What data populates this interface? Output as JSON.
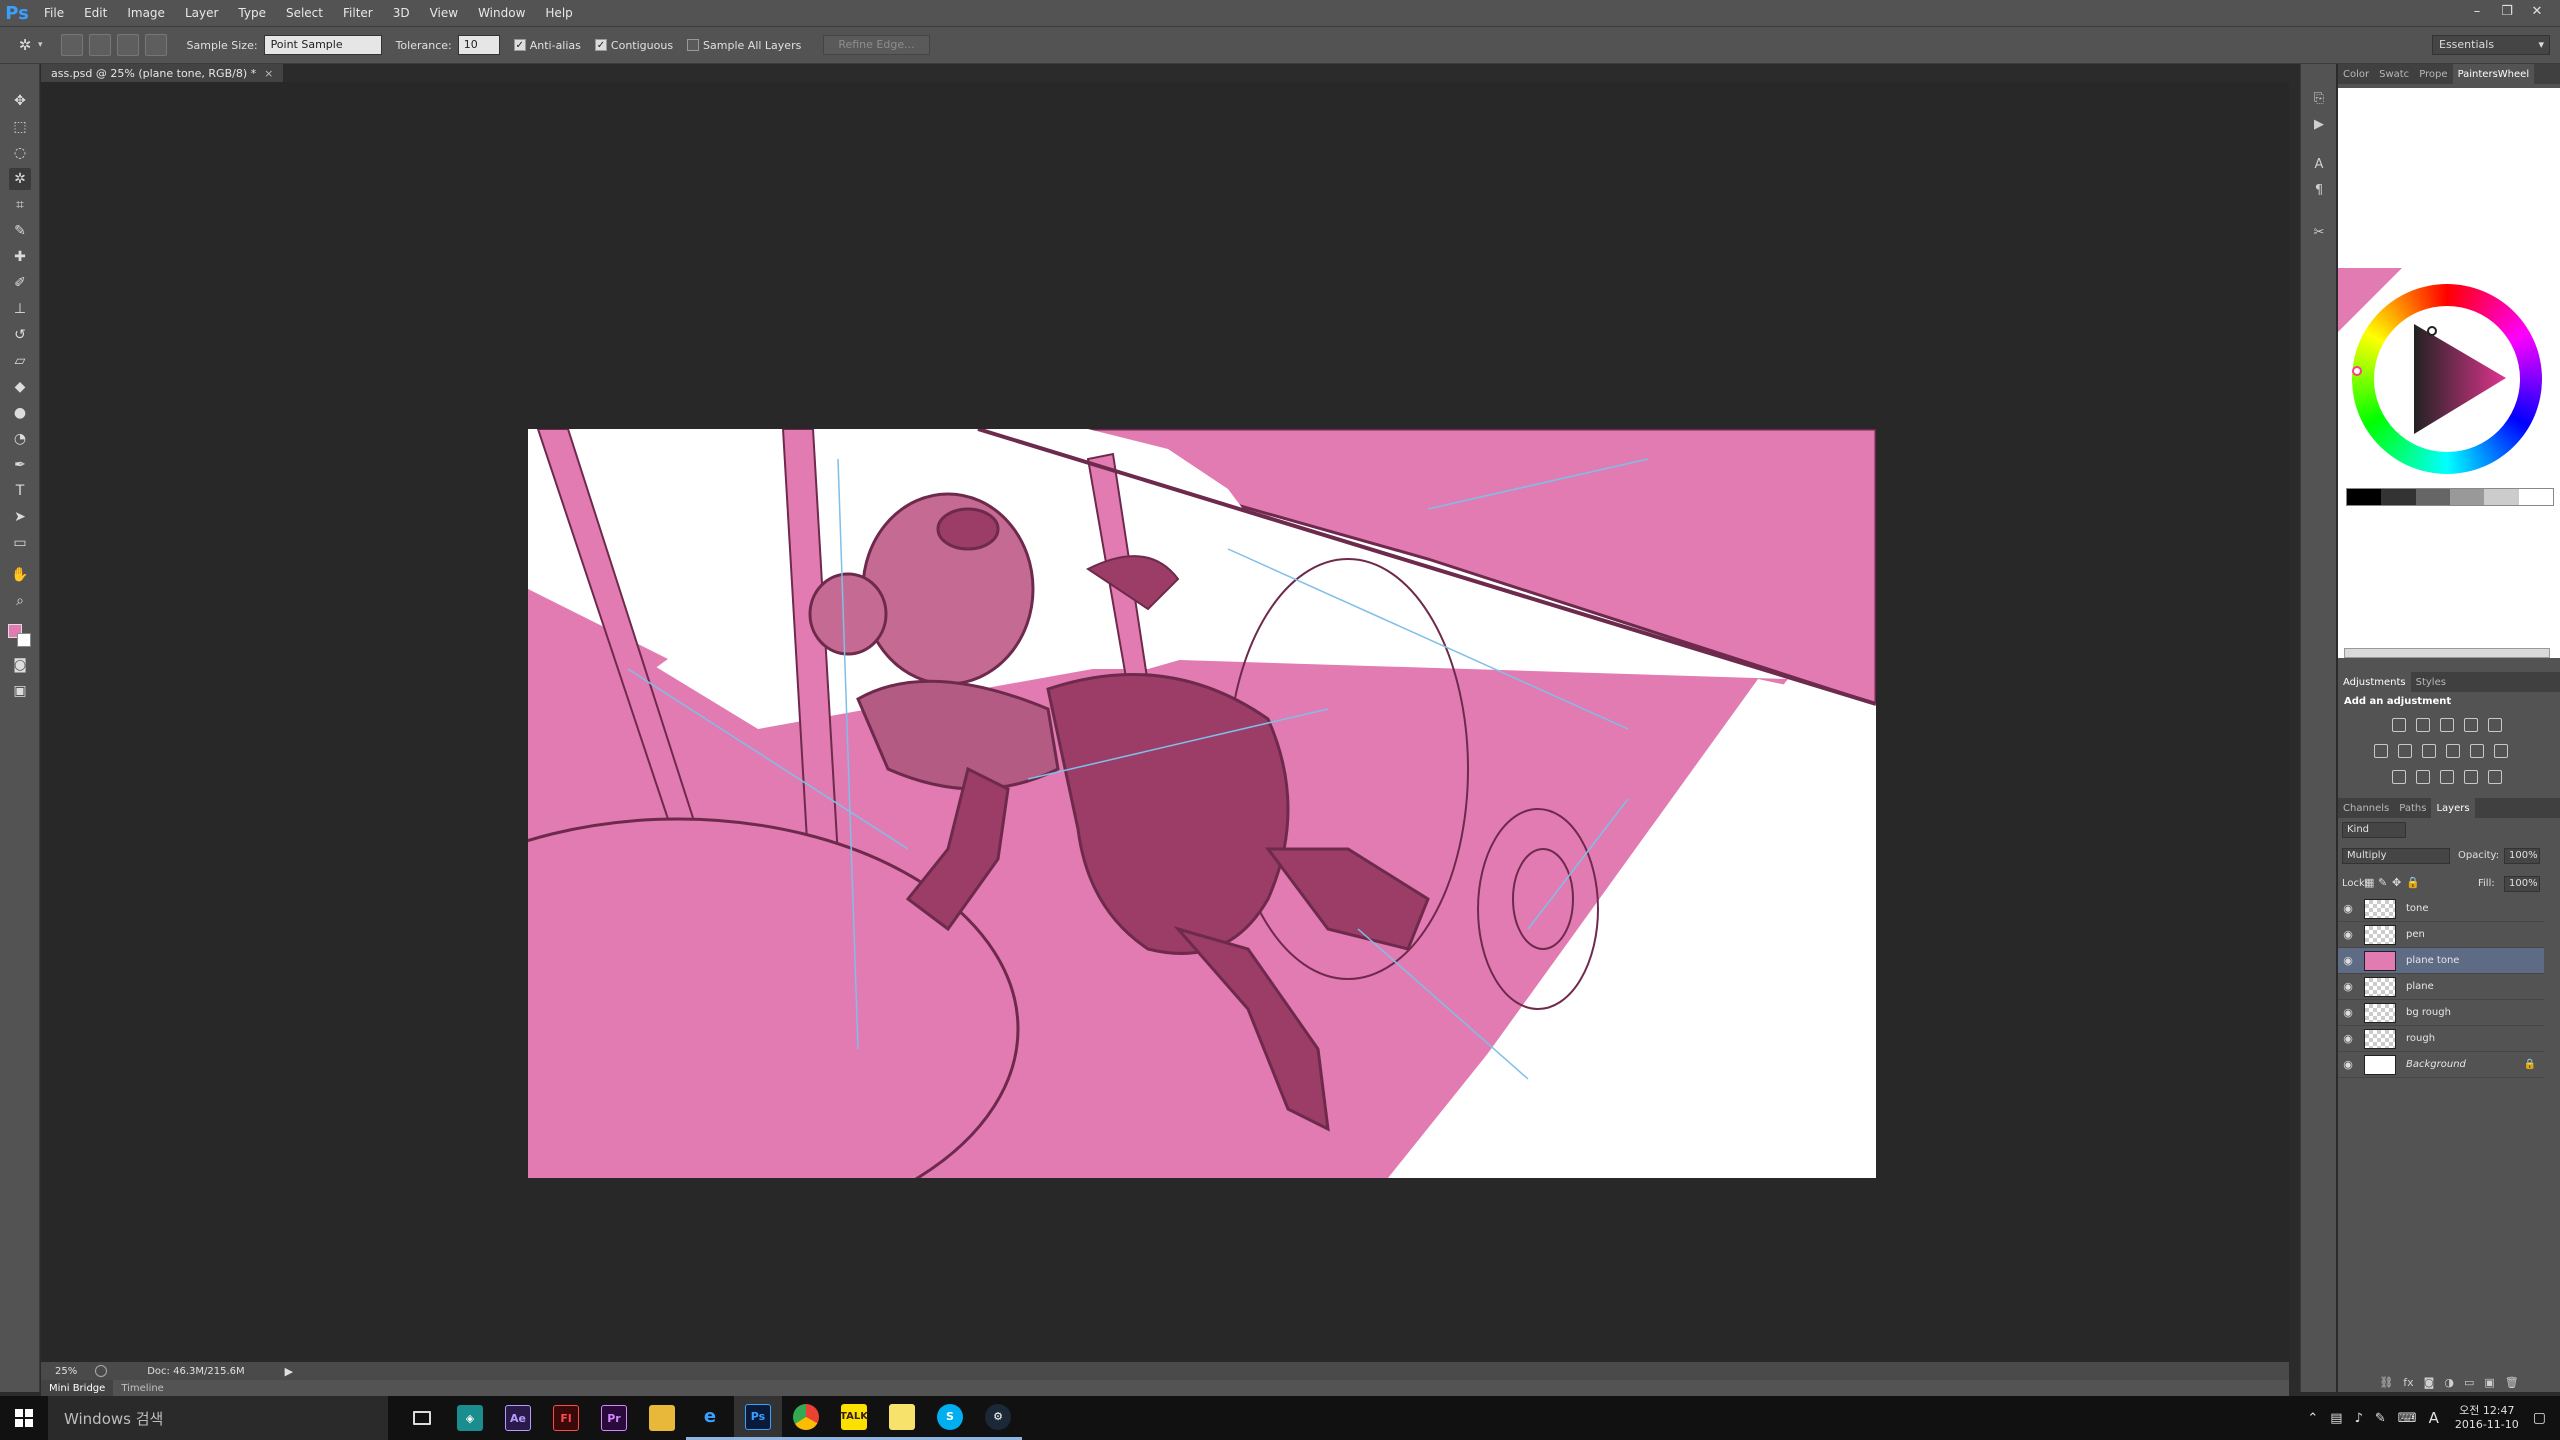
{
  "menu": {
    "logo": "Ps",
    "items": [
      "File",
      "Edit",
      "Image",
      "Layer",
      "Type",
      "Select",
      "Filter",
      "3D",
      "View",
      "Window",
      "Help"
    ],
    "window_controls": [
      "–",
      "❐",
      "✕"
    ]
  },
  "options": {
    "sample_size_label": "Sample Size:",
    "sample_size_value": "Point Sample",
    "tolerance_label": "Tolerance:",
    "tolerance_value": "10",
    "antialias_label": "Anti-alias",
    "contiguous_label": "Contiguous",
    "sample_all_label": "Sample All Layers",
    "refine_edge_label": "Refine Edge...",
    "workspace": "Essentials"
  },
  "document": {
    "tab_title": "ass.psd @ 25% (plane tone, RGB/8) *",
    "close": "×",
    "zoom": "25%",
    "doc_size": "Doc: 46.3M/215.6M"
  },
  "bottom_tabs": [
    "Mini Bridge",
    "Timeline"
  ],
  "color_panel": {
    "tabs": [
      "Color",
      "Swatc",
      "Prope",
      "PaintersWheel"
    ],
    "active_tab": "PaintersWheel",
    "foreground": "#e27bb1",
    "background": "#ffffff"
  },
  "adjustments": {
    "tabs": [
      "Adjustments",
      "Styles"
    ],
    "active_tab": "Adjustments",
    "title": "Add an adjustment"
  },
  "layers_panel": {
    "tabs": [
      "Channels",
      "Paths",
      "Layers"
    ],
    "active_tab": "Layers",
    "kind_label": "Kind",
    "blend_mode": "Multiply",
    "opacity_label": "Opacity:",
    "opacity_value": "100%",
    "lock_label": "Lock:",
    "fill_label": "Fill:",
    "fill_value": "100%",
    "layers": [
      {
        "name": "tone",
        "selected": false
      },
      {
        "name": "pen",
        "selected": false
      },
      {
        "name": "plane tone",
        "selected": true
      },
      {
        "name": "plane",
        "selected": false
      },
      {
        "name": "bg rough",
        "selected": false
      },
      {
        "name": "rough",
        "selected": false
      },
      {
        "name": "Background",
        "selected": false,
        "locked": true
      }
    ]
  },
  "taskbar": {
    "search_placeholder": "Windows 검색",
    "apps": [
      "task-view",
      "maps",
      "after-effects",
      "flash",
      "premiere",
      "file-explorer",
      "internet-explorer",
      "photoshop",
      "chrome",
      "kakaotalk",
      "sticky-notes",
      "skype",
      "steam"
    ],
    "ime": "A",
    "time": "오전 12:47",
    "date": "2016-11-10"
  },
  "colors": {
    "artwork_pink": "#e27bb1",
    "artwork_line": "#6e2a4c",
    "artwork_shade": "#9b3d66",
    "sketch_blue": "#7fbfe8"
  }
}
